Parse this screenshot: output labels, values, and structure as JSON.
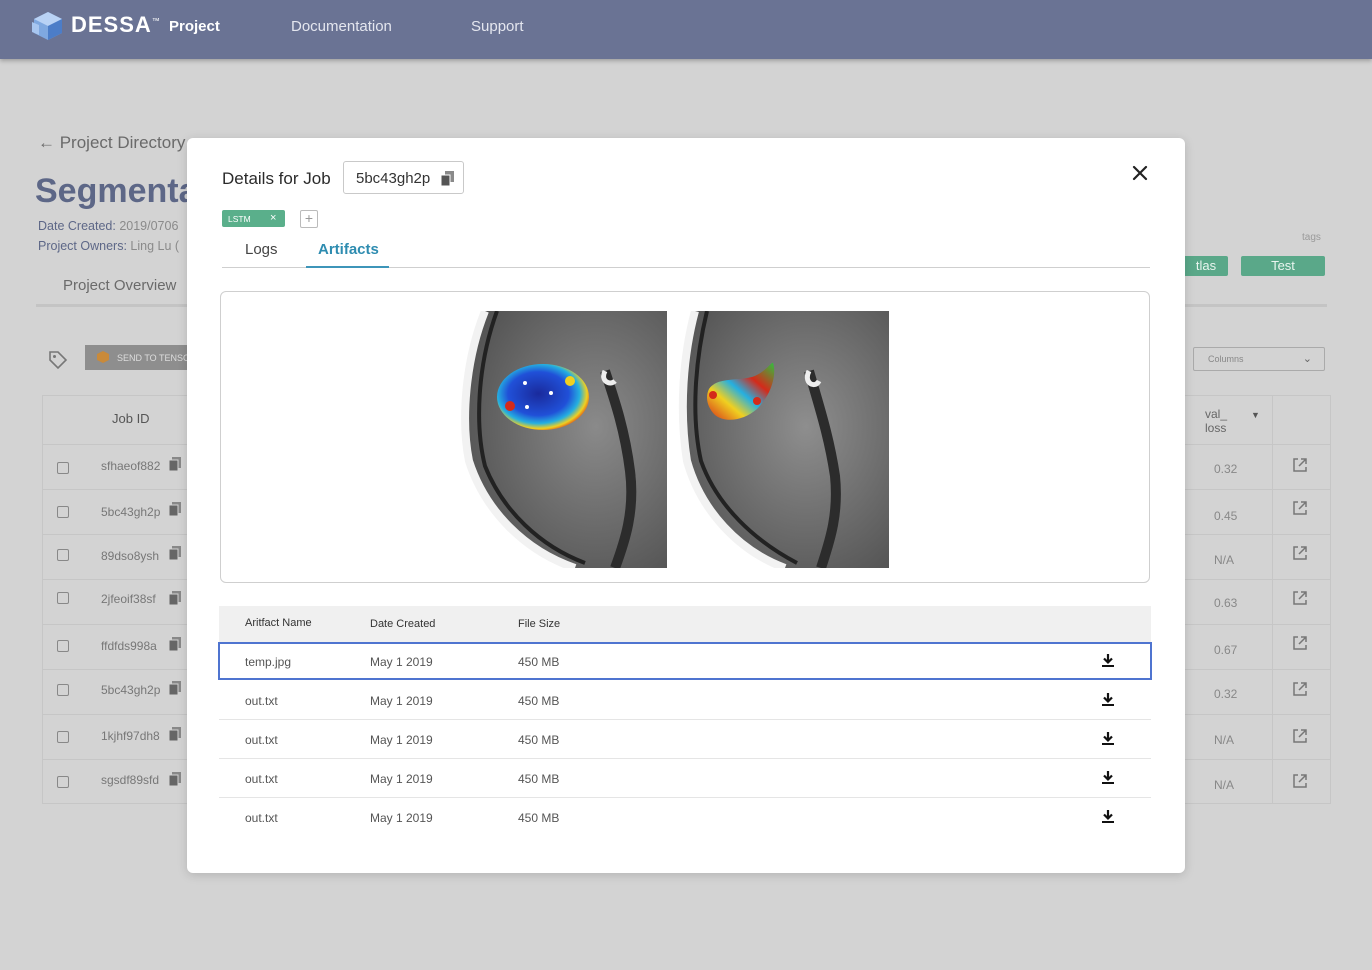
{
  "app": {
    "brand": "DESSA",
    "brand_mark": "™"
  },
  "nav": {
    "project": "Project",
    "documentation": "Documentation",
    "support": "Support"
  },
  "background": {
    "back_link": "← Project Directory",
    "title": "Segmenta",
    "date_created_label": "Date Created:",
    "date_created_value": "2019/0706",
    "owners_label": "Project Owners:",
    "owners_value": "Ling Lu (",
    "overview_tab": "Project Overview",
    "send_button": "SEND TO TENSO",
    "tags_label": "tags",
    "tags": [
      "tlas",
      "Test"
    ],
    "columns_select": "Columns",
    "table": {
      "col_jobid": "Job ID",
      "col_val_line1": "val_",
      "col_val_line2": "loss",
      "rows": [
        {
          "job_id": "sfhaeof882",
          "val_loss": "0.32"
        },
        {
          "job_id": "5bc43gh2p",
          "val_loss": "0.45"
        },
        {
          "job_id": "89dso8ysh",
          "val_loss": "N/A"
        },
        {
          "job_id": "2jfeoif38sf",
          "val_loss": "0.63"
        },
        {
          "job_id": "ffdfds998a",
          "val_loss": "0.67"
        },
        {
          "job_id": "5bc43gh2p",
          "val_loss": "0.32"
        },
        {
          "job_id": "1kjhf97dh8",
          "val_loss": "N/A"
        },
        {
          "job_id": "sgsdf89sfd",
          "val_loss": "N/A"
        }
      ]
    }
  },
  "modal": {
    "title": "Details for Job",
    "job_id": "5bc43gh2p",
    "tag": "LSTM",
    "tabs": [
      "Logs",
      "Artifacts"
    ],
    "active_tab": "Artifacts",
    "artifacts_table": {
      "headers": {
        "name": "Aritfact Name",
        "date": "Date Created",
        "size": "File Size"
      },
      "rows": [
        {
          "name": "temp.jpg",
          "date": "May 1 2019",
          "size": "450 MB",
          "selected": true
        },
        {
          "name": "out.txt",
          "date": "May 1 2019",
          "size": "450 MB",
          "selected": false
        },
        {
          "name": "out.txt",
          "date": "May 1 2019",
          "size": "450 MB",
          "selected": false
        },
        {
          "name": "out.txt",
          "date": "May 1 2019",
          "size": "450 MB",
          "selected": false
        },
        {
          "name": "out.txt",
          "date": "May 1 2019",
          "size": "450 MB",
          "selected": false
        }
      ]
    }
  },
  "colors": {
    "nav_bg": "#6a7394",
    "accent": "#3d95b9",
    "tag_green": "#5aaf8b",
    "selected_border": "#4f74d0",
    "overlay": "#d3d3d3"
  },
  "icons": {
    "logo": "dessa-cube-logo",
    "copy": "copy-icon",
    "close": "close-icon",
    "download": "download-icon",
    "external": "external-link-icon",
    "tag": "tag-icon"
  }
}
